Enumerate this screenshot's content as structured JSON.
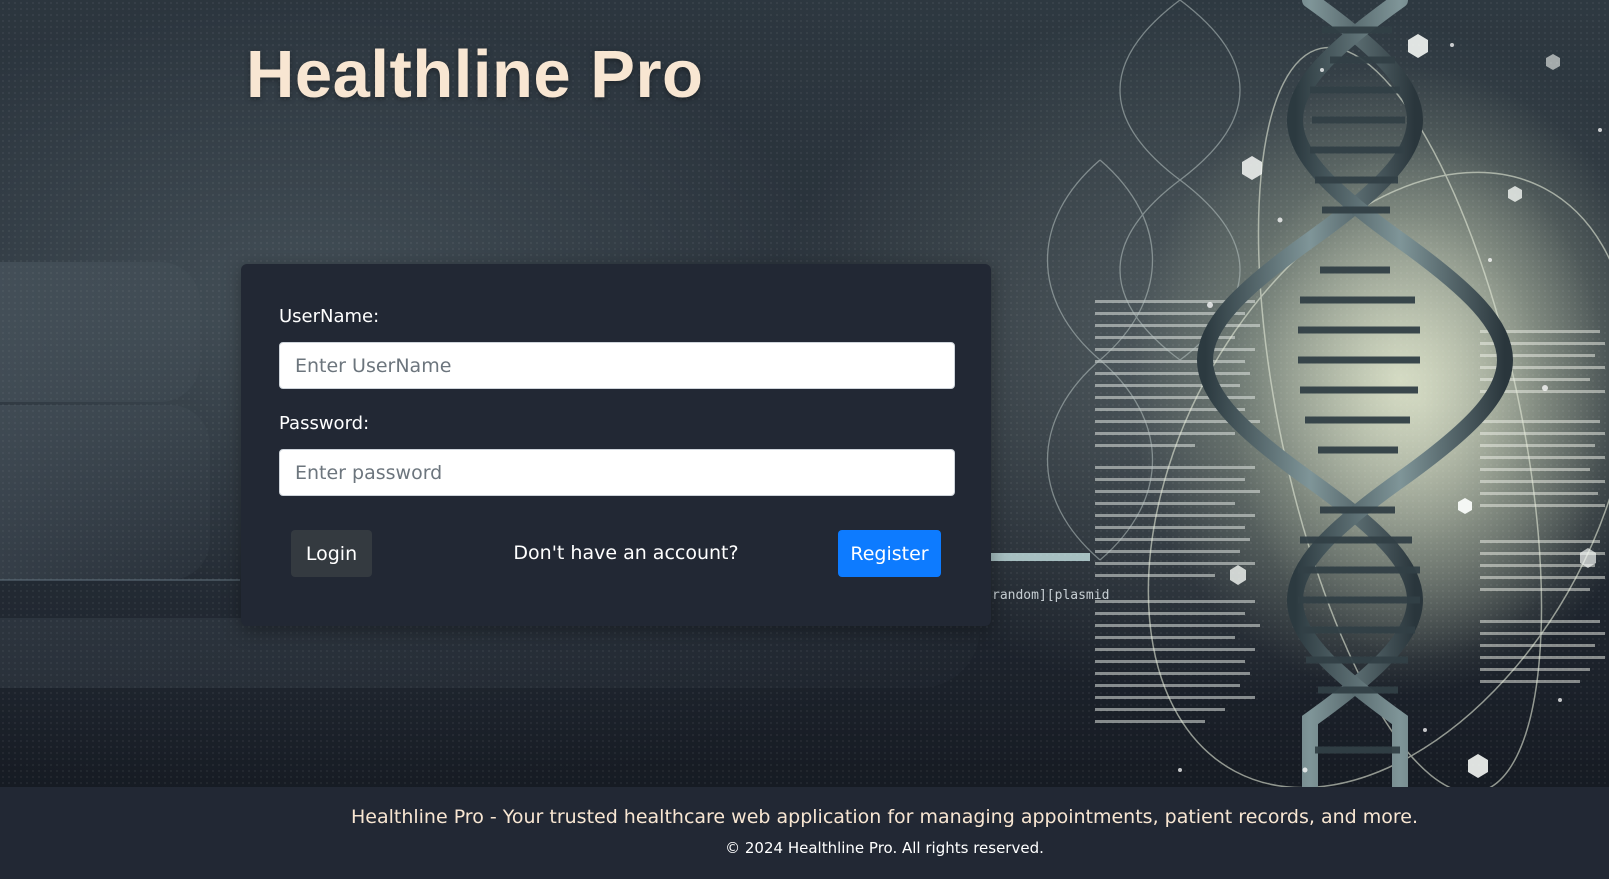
{
  "app": {
    "title": "Healthline Pro"
  },
  "hero": {
    "background_art": "dna-helix-illustration",
    "code_snippet": "random][plasmid"
  },
  "login_form": {
    "username": {
      "label": "UserName:",
      "value": "",
      "placeholder": "Enter UserName"
    },
    "password": {
      "label": "Password:",
      "value": "",
      "placeholder": "Enter password"
    },
    "login_label": "Login",
    "no_account_text": "Don't have an account?",
    "register_label": "Register"
  },
  "footer": {
    "tagline": "Healthline Pro - Your trusted healthcare web application for managing appointments, patient records, and more.",
    "copyright": "© 2024 Healthline Pro. All rights reserved."
  },
  "colors": {
    "title": "#f8e6d2",
    "card_background": "#222834",
    "footer_background": "#222834",
    "login_button": "#343a40",
    "register_button": "#0d7bff"
  }
}
